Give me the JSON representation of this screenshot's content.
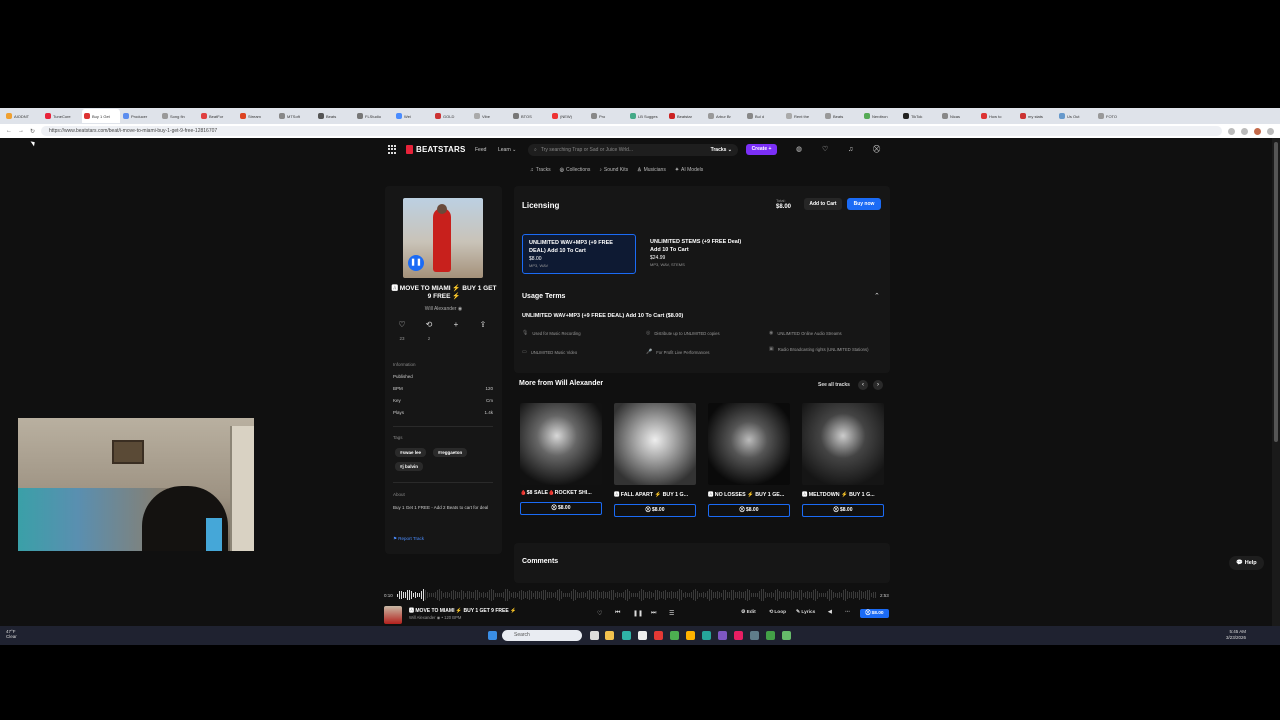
{
  "browser": {
    "tabs": [
      "AIODNT",
      "TuneCore",
      "Buy 1 Get",
      "Producer",
      "Song fin",
      "BeatFor",
      "Stream",
      "MTSoft",
      "Beats",
      "FLStudio",
      "Wei",
      "GOLD",
      "Vibe",
      "BTOS",
      "(NEW)",
      "Pro",
      "LB Sugges",
      "Beatstar",
      "Arbur Br",
      "Bul d",
      "Rent the",
      "Beats",
      "Nerdtron",
      "TikTok",
      "Nicas",
      "How to",
      "my stats",
      "Us Out",
      "FOTO"
    ],
    "url": "https://www.beatstars.com/beat/i-move-to-miami-buy-1-get-9-free-12816707",
    "nav_back": "←",
    "nav_forward": "→",
    "nav_reload": "↻"
  },
  "site": {
    "logo": "BEATSTARS",
    "nav": [
      "Feed",
      "Learn ⌄"
    ],
    "search_placeholder": "Try searching Trap or Sad or Juice Wrld...",
    "search_scope": "Tracks ⌄",
    "create": "Create +",
    "subnav": [
      {
        "icon": "♫",
        "label": "Tracks"
      },
      {
        "icon": "◎",
        "label": "Collections"
      },
      {
        "icon": "♪",
        "label": "Sound Kits"
      },
      {
        "icon": "♙",
        "label": "Musicians"
      },
      {
        "icon": "✦",
        "label": "AI Models"
      }
    ]
  },
  "beat": {
    "title": "🅰 MOVE TO MIAMI ⚡ BUY 1 GET 9 FREE ⚡",
    "artist": "Will Alexander ◉",
    "play_icon": "❚❚",
    "actions": [
      {
        "icon": "♡",
        "count": "23"
      },
      {
        "icon": "⟲",
        "count": "2"
      },
      {
        "icon": "+",
        "count": ""
      },
      {
        "icon": "⇪",
        "count": ""
      }
    ],
    "info_label": "Information",
    "info": [
      {
        "k": "Published",
        "v": ""
      },
      {
        "k": "BPM",
        "v": "120"
      },
      {
        "k": "Key",
        "v": "Cm"
      },
      {
        "k": "Plays",
        "v": "1.4k"
      }
    ],
    "tags_label": "Tags",
    "tags": [
      "#swae lee",
      "#reggaeton",
      "#j balvin"
    ],
    "about_label": "About",
    "about": "Buy 1 Get 1 FREE - Add 2 Beats to cart for deal",
    "report": "⚑ Report Track"
  },
  "licensing": {
    "title": "Licensing",
    "total_label": "Total:",
    "total_value": "$8.00",
    "add_to_cart": "Add to Cart",
    "buy_now": "Buy now",
    "options": [
      {
        "name": "UNLIMITED WAV+MP3 (+9 FREE DEAL) Add 10 To Cart",
        "price": "$8.00",
        "files": "MP3, WAV"
      },
      {
        "name": "UNLIMITED STEMS (+9 FREE Deal) Add 10 To Cart",
        "price": "$24.99",
        "files": "MP3, WAV, STEMS"
      }
    ],
    "usage_title": "Usage Terms",
    "usage_caret": "⌃",
    "usage_subtitle": "UNLIMITED WAV+MP3 (+9 FREE DEAL) Add 10 To Cart ($8.00)",
    "terms": [
      {
        "icon": "🎙",
        "text": "Used for Music Recording"
      },
      {
        "icon": "◎",
        "text": "Distribute up to UNLIMITED copies"
      },
      {
        "icon": "◉",
        "text": "UNLIMITED Online Audio Streams"
      },
      {
        "icon": "▭",
        "text": "UNLIMITED Music Video"
      },
      {
        "icon": "🎤",
        "text": "For Profit Live Performances"
      },
      {
        "icon": "▣",
        "text": "Radio Broadcasting rights (UNLIMITED Stations)"
      }
    ]
  },
  "more": {
    "title": "More from Will Alexander",
    "see_all": "See all tracks",
    "prev": "‹",
    "next": "›",
    "tracks": [
      {
        "title": "🩸$8 SALE🩸ROCKET SHI...",
        "price": "⛒ $8.00"
      },
      {
        "title": "🅰 FALL APART ⚡ BUY 1 G...",
        "price": "⛒ $8.00"
      },
      {
        "title": "🅰 NO LOSSES ⚡ BUY 1 GE...",
        "price": "⛒ $8.00"
      },
      {
        "title": "🅰 MELTDOWN ⚡ BUY 1 G...",
        "price": "⛒ $8.00"
      }
    ]
  },
  "comments": {
    "title": "Comments"
  },
  "help": "💬 Help",
  "player": {
    "time_current": "0:10",
    "time_total": "2:53",
    "title": "🅰 MOVE TO MIAMI ⚡ BUY 1 GET 9 FREE ⚡",
    "artist": "Will Alexander ◉ • 120 BPM",
    "controls": [
      "♡",
      "⏮",
      "❚❚",
      "⏭",
      "☰"
    ],
    "edit": "⚙ Edit",
    "loop": "⟲ Loop",
    "lyrics": "✎ Lyrics",
    "volume": "◀",
    "more": "⋯",
    "price": "⛒ $8.00"
  },
  "taskbar": {
    "weather_temp": "47°F",
    "weather_desc": "Clear",
    "search": "Search",
    "time": "5:45 AM",
    "date": "3/23/2026"
  }
}
